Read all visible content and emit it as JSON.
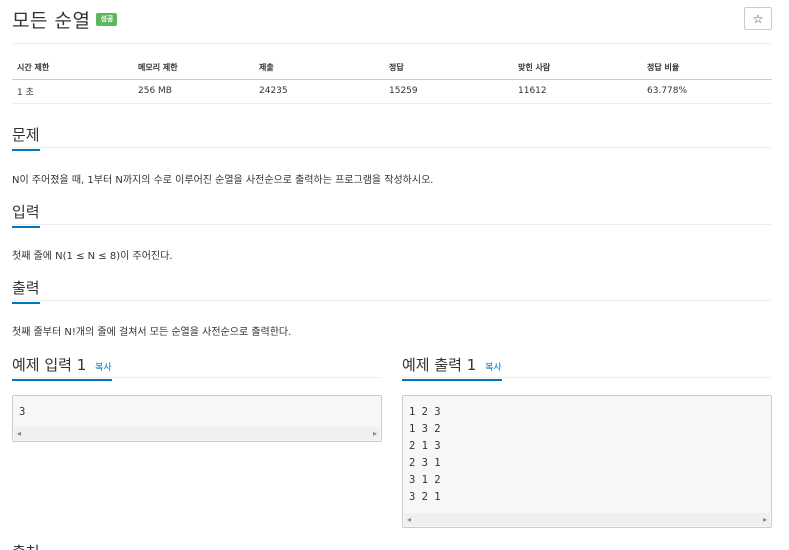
{
  "title": "모든 순열",
  "badge": "성공",
  "star_icon": "☆",
  "info_table": {
    "headers": [
      "시간 제한",
      "메모리 제한",
      "제출",
      "정답",
      "맞힌 사람",
      "정답 비율"
    ],
    "row": [
      "1 초",
      "256 MB",
      "24235",
      "15259",
      "11612",
      "63.778%"
    ]
  },
  "sections": {
    "problem": {
      "title": "문제",
      "text": "N이 주어졌을 때, 1부터 N까지의 수로 이루어진 순열을 사전순으로 출력하는 프로그램을 작성하시오."
    },
    "input": {
      "title": "입력",
      "text": "첫째 줄에 N(1 ≤ N ≤ 8)이 주어진다."
    },
    "output": {
      "title": "출력",
      "text": "첫째 줄부터 N!개의 줄에 걸쳐서 모든 순열을 사전순으로 출력한다."
    }
  },
  "examples": {
    "input": {
      "title": "예제 입력 1",
      "copy": "복사",
      "lines": [
        "3"
      ]
    },
    "output": {
      "title": "예제 출력 1",
      "copy": "복사",
      "lines": [
        "1 2 3",
        "1 3 2",
        "2 1 3",
        "2 3 1",
        "3 1 2",
        "3 2 1"
      ]
    }
  },
  "scroll_arrows": {
    "left": "◂",
    "right": "▸"
  },
  "next_section_partial": "출처",
  "colors": {
    "accent": "#0076c0",
    "badge": "#5cb85c",
    "pre_bg": "#f7f7f9"
  }
}
